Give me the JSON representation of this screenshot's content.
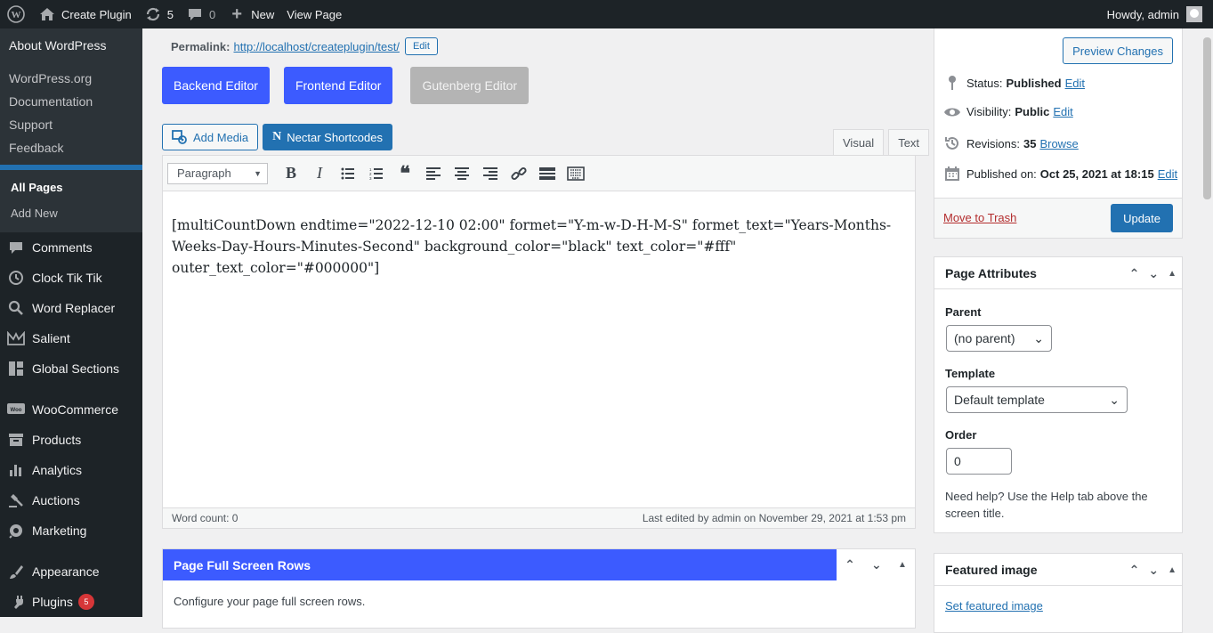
{
  "adminbar": {
    "site": "Create Plugin",
    "updates": "5",
    "comments": "0",
    "new": "New",
    "view": "View Page",
    "howdy": "Howdy, admin"
  },
  "sidebar": {
    "about": "About WordPress",
    "wp_links": [
      "WordPress.org",
      "Documentation",
      "Support",
      "Feedback"
    ],
    "pages_sub": [
      "All Pages",
      "Add New"
    ],
    "menu": [
      {
        "label": "Comments",
        "icon": "comment-icon"
      },
      {
        "label": "Clock Tik Tik",
        "icon": "clock-icon"
      },
      {
        "label": "Word Replacer",
        "icon": "search-icon"
      },
      {
        "label": "Salient",
        "icon": "salient-icon"
      },
      {
        "label": "Global Sections",
        "icon": "grid-icon"
      }
    ],
    "menu2": [
      {
        "label": "WooCommerce",
        "icon": "woo-icon"
      },
      {
        "label": "Products",
        "icon": "archive-icon"
      },
      {
        "label": "Analytics",
        "icon": "bar-chart-icon"
      },
      {
        "label": "Auctions",
        "icon": "gavel-icon"
      },
      {
        "label": "Marketing",
        "icon": "megaphone-icon"
      }
    ],
    "menu3": [
      {
        "label": "Appearance",
        "icon": "brush-icon"
      },
      {
        "label": "Plugins",
        "icon": "plug-icon",
        "badge": "5"
      }
    ]
  },
  "permalink": {
    "label": "Permalink:",
    "url": "http://localhost/createplugin/test/",
    "edit": "Edit"
  },
  "editors": {
    "backend": "Backend Editor",
    "frontend": "Frontend Editor",
    "gutenberg": "Gutenberg Editor"
  },
  "media": {
    "add_media": "Add Media",
    "nectar": "Nectar Shortcodes"
  },
  "tabs": {
    "visual": "Visual",
    "text": "Text"
  },
  "toolbar": {
    "format": "Paragraph"
  },
  "content": "[multiCountDown endtime=\"2022-12-10 02:00\" formet=\"Y-m-w-D-H-M-S\" formet_text=\"Years-Months-Weeks-Day-Hours-Minutes-Second\" background_color=\"black\" text_color=\"#fff\" outer_text_color=\"#000000\"]",
  "status": {
    "word_count": "Word count: 0",
    "last_edited": "Last edited by admin on November 29, 2021 at 1:53 pm"
  },
  "fullscreen": {
    "title": "Page Full Screen Rows",
    "desc": "Configure your page full screen rows."
  },
  "publish": {
    "preview": "Preview Changes",
    "status_label": "Status:",
    "status_value": "Published",
    "status_edit": "Edit",
    "visibility_label": "Visibility:",
    "visibility_value": "Public",
    "visibility_edit": "Edit",
    "revisions_label": "Revisions:",
    "revisions_value": "35",
    "revisions_browse": "Browse",
    "published_label": "Published on:",
    "published_value": "Oct 25, 2021 at 18:15",
    "published_edit": "Edit",
    "trash": "Move to Trash",
    "update": "Update"
  },
  "attributes": {
    "title": "Page Attributes",
    "parent_label": "Parent",
    "parent_value": "(no parent)",
    "template_label": "Template",
    "template_value": "Default template",
    "order_label": "Order",
    "order_value": "0",
    "help": "Need help? Use the Help tab above the screen title."
  },
  "featured": {
    "title": "Featured image",
    "link": "Set featured image"
  }
}
